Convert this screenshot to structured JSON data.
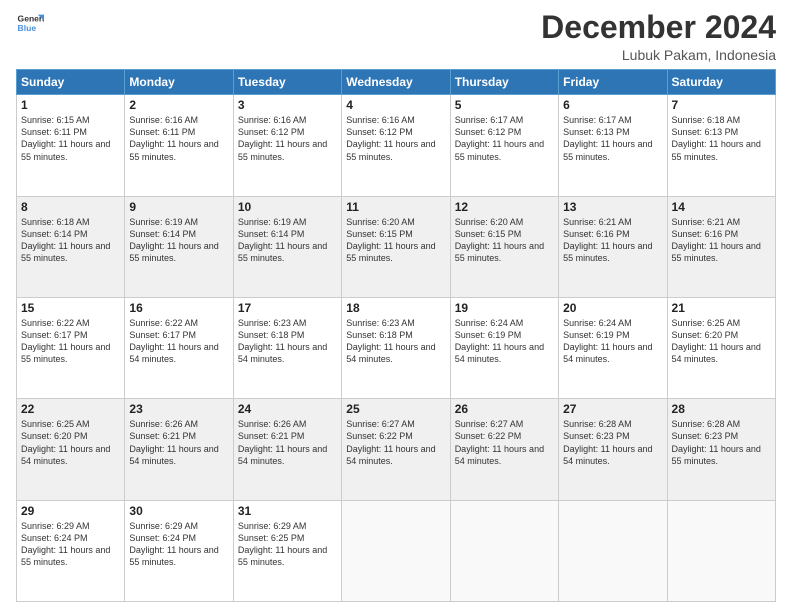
{
  "header": {
    "logo": {
      "line1": "General",
      "line2": "Blue"
    },
    "title": "December 2024",
    "location": "Lubuk Pakam, Indonesia"
  },
  "days_of_week": [
    "Sunday",
    "Monday",
    "Tuesday",
    "Wednesday",
    "Thursday",
    "Friday",
    "Saturday"
  ],
  "weeks": [
    [
      {
        "day": "1",
        "sunrise": "6:15 AM",
        "sunset": "6:11 PM",
        "daylight": "11 hours and 55 minutes."
      },
      {
        "day": "2",
        "sunrise": "6:16 AM",
        "sunset": "6:11 PM",
        "daylight": "11 hours and 55 minutes."
      },
      {
        "day": "3",
        "sunrise": "6:16 AM",
        "sunset": "6:12 PM",
        "daylight": "11 hours and 55 minutes."
      },
      {
        "day": "4",
        "sunrise": "6:16 AM",
        "sunset": "6:12 PM",
        "daylight": "11 hours and 55 minutes."
      },
      {
        "day": "5",
        "sunrise": "6:17 AM",
        "sunset": "6:12 PM",
        "daylight": "11 hours and 55 minutes."
      },
      {
        "day": "6",
        "sunrise": "6:17 AM",
        "sunset": "6:13 PM",
        "daylight": "11 hours and 55 minutes."
      },
      {
        "day": "7",
        "sunrise": "6:18 AM",
        "sunset": "6:13 PM",
        "daylight": "11 hours and 55 minutes."
      }
    ],
    [
      {
        "day": "8",
        "sunrise": "6:18 AM",
        "sunset": "6:14 PM",
        "daylight": "11 hours and 55 minutes."
      },
      {
        "day": "9",
        "sunrise": "6:19 AM",
        "sunset": "6:14 PM",
        "daylight": "11 hours and 55 minutes."
      },
      {
        "day": "10",
        "sunrise": "6:19 AM",
        "sunset": "6:14 PM",
        "daylight": "11 hours and 55 minutes."
      },
      {
        "day": "11",
        "sunrise": "6:20 AM",
        "sunset": "6:15 PM",
        "daylight": "11 hours and 55 minutes."
      },
      {
        "day": "12",
        "sunrise": "6:20 AM",
        "sunset": "6:15 PM",
        "daylight": "11 hours and 55 minutes."
      },
      {
        "day": "13",
        "sunrise": "6:21 AM",
        "sunset": "6:16 PM",
        "daylight": "11 hours and 55 minutes."
      },
      {
        "day": "14",
        "sunrise": "6:21 AM",
        "sunset": "6:16 PM",
        "daylight": "11 hours and 55 minutes."
      }
    ],
    [
      {
        "day": "15",
        "sunrise": "6:22 AM",
        "sunset": "6:17 PM",
        "daylight": "11 hours and 55 minutes."
      },
      {
        "day": "16",
        "sunrise": "6:22 AM",
        "sunset": "6:17 PM",
        "daylight": "11 hours and 54 minutes."
      },
      {
        "day": "17",
        "sunrise": "6:23 AM",
        "sunset": "6:18 PM",
        "daylight": "11 hours and 54 minutes."
      },
      {
        "day": "18",
        "sunrise": "6:23 AM",
        "sunset": "6:18 PM",
        "daylight": "11 hours and 54 minutes."
      },
      {
        "day": "19",
        "sunrise": "6:24 AM",
        "sunset": "6:19 PM",
        "daylight": "11 hours and 54 minutes."
      },
      {
        "day": "20",
        "sunrise": "6:24 AM",
        "sunset": "6:19 PM",
        "daylight": "11 hours and 54 minutes."
      },
      {
        "day": "21",
        "sunrise": "6:25 AM",
        "sunset": "6:20 PM",
        "daylight": "11 hours and 54 minutes."
      }
    ],
    [
      {
        "day": "22",
        "sunrise": "6:25 AM",
        "sunset": "6:20 PM",
        "daylight": "11 hours and 54 minutes."
      },
      {
        "day": "23",
        "sunrise": "6:26 AM",
        "sunset": "6:21 PM",
        "daylight": "11 hours and 54 minutes."
      },
      {
        "day": "24",
        "sunrise": "6:26 AM",
        "sunset": "6:21 PM",
        "daylight": "11 hours and 54 minutes."
      },
      {
        "day": "25",
        "sunrise": "6:27 AM",
        "sunset": "6:22 PM",
        "daylight": "11 hours and 54 minutes."
      },
      {
        "day": "26",
        "sunrise": "6:27 AM",
        "sunset": "6:22 PM",
        "daylight": "11 hours and 54 minutes."
      },
      {
        "day": "27",
        "sunrise": "6:28 AM",
        "sunset": "6:23 PM",
        "daylight": "11 hours and 54 minutes."
      },
      {
        "day": "28",
        "sunrise": "6:28 AM",
        "sunset": "6:23 PM",
        "daylight": "11 hours and 55 minutes."
      }
    ],
    [
      {
        "day": "29",
        "sunrise": "6:29 AM",
        "sunset": "6:24 PM",
        "daylight": "11 hours and 55 minutes."
      },
      {
        "day": "30",
        "sunrise": "6:29 AM",
        "sunset": "6:24 PM",
        "daylight": "11 hours and 55 minutes."
      },
      {
        "day": "31",
        "sunrise": "6:29 AM",
        "sunset": "6:25 PM",
        "daylight": "11 hours and 55 minutes."
      },
      null,
      null,
      null,
      null
    ]
  ]
}
